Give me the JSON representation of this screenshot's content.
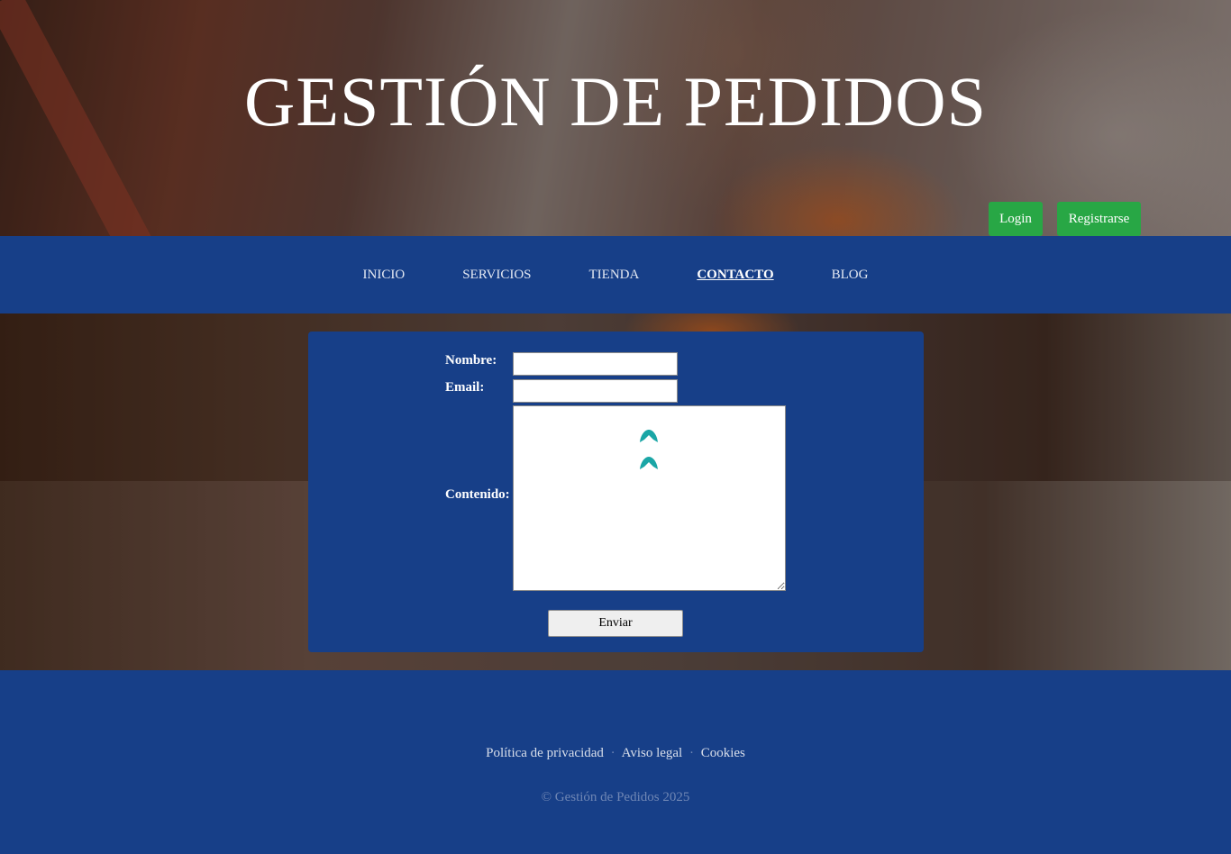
{
  "header": {
    "title": "GESTIÓN DE PEDIDOS",
    "login_label": "Login",
    "register_label": "Registrarse"
  },
  "nav": {
    "items": [
      {
        "label": "INICIO"
      },
      {
        "label": "SERVICIOS"
      },
      {
        "label": "TIENDA"
      },
      {
        "label": "CONTACTO",
        "active": true
      },
      {
        "label": "BLOG"
      }
    ]
  },
  "form": {
    "nombre_label": "Nombre:",
    "nombre_value": "",
    "email_label": "Email:",
    "email_value": "",
    "contenido_label": "Contenido:",
    "contenido_value": "",
    "submit_label": "Enviar"
  },
  "footer": {
    "links": [
      {
        "label": "Política de privacidad"
      },
      {
        "label": "Aviso legal"
      },
      {
        "label": "Cookies"
      }
    ],
    "separator": "·",
    "copyright": "© Gestión de Pedidos 2025"
  },
  "colors": {
    "primary": "#173f88",
    "button_green": "#28a745",
    "textarea_icon": "#1aa6a6"
  },
  "icons": {
    "textarea_extension": "chevron-up-icon"
  }
}
